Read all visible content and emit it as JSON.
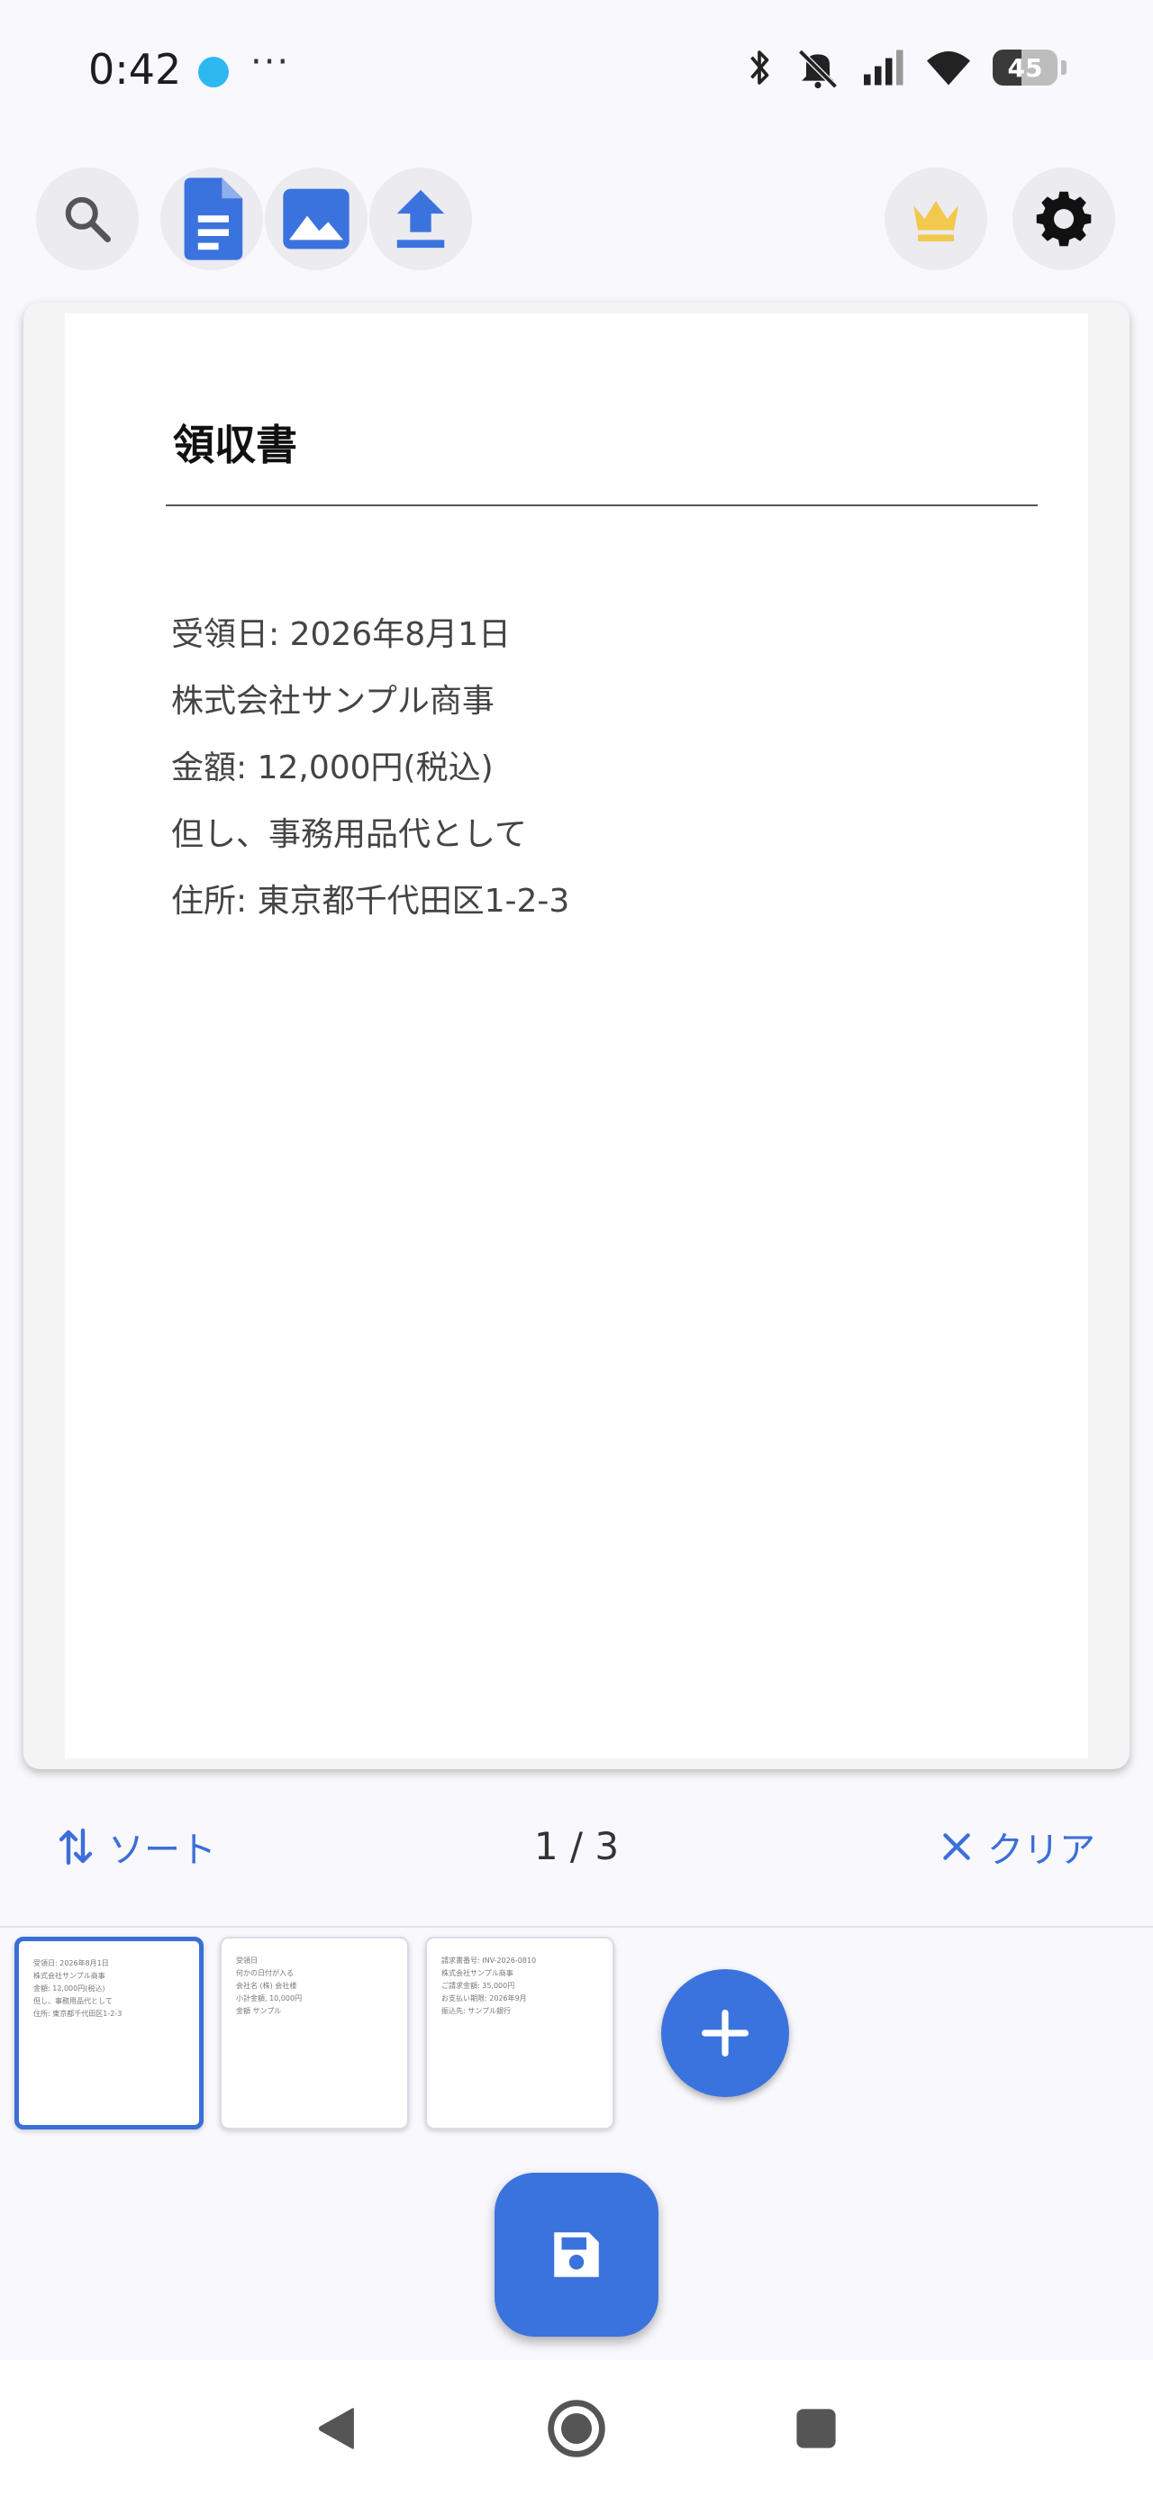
{
  "status_bar": {
    "time": "0:42",
    "more": "···",
    "battery_level": 45,
    "battery_label": "45"
  },
  "toolbar": {
    "search_icon": "search-icon",
    "document_icon": "document-icon",
    "image_icon": "image-icon",
    "upload_icon": "upload-icon",
    "premium_icon": "crown-icon",
    "settings_icon": "gear-icon"
  },
  "document": {
    "title": "領収書",
    "lines": [
      "受領日: 2026年8月1日",
      "株式会社サンプル商事",
      "金額: 12,000円(税込)",
      "但し、事務用品代として",
      "住所: 東京都千代田区1-2-3"
    ]
  },
  "controls": {
    "sort_label": "ソート",
    "page_indicator": "1 / 3",
    "clear_label": "クリア"
  },
  "thumbnails": [
    {
      "selected": true,
      "lines": [
        "受領日: 2026年8月1日",
        "株式会社サンプル商事",
        "金額: 12,000円(税込)",
        "但し、事務用品代として",
        "住所: 東京都千代田区1-2-3"
      ]
    },
    {
      "selected": false,
      "lines": [
        "受領日",
        "何かの日付が入る",
        "会社名 (株) 会社様",
        "小計金額, 10,000円",
        "金額 サンプル"
      ]
    },
    {
      "selected": false,
      "lines": [
        "請求書番号: INV-2026-0810",
        "株式会社サンプル商事",
        "ご請求金額: 35,000円",
        "お支払い期限: 2026年9月",
        "振込先: サンプル銀行"
      ]
    }
  ],
  "colors": {
    "accent": "#3b73de",
    "crown": "#f2c94c"
  }
}
